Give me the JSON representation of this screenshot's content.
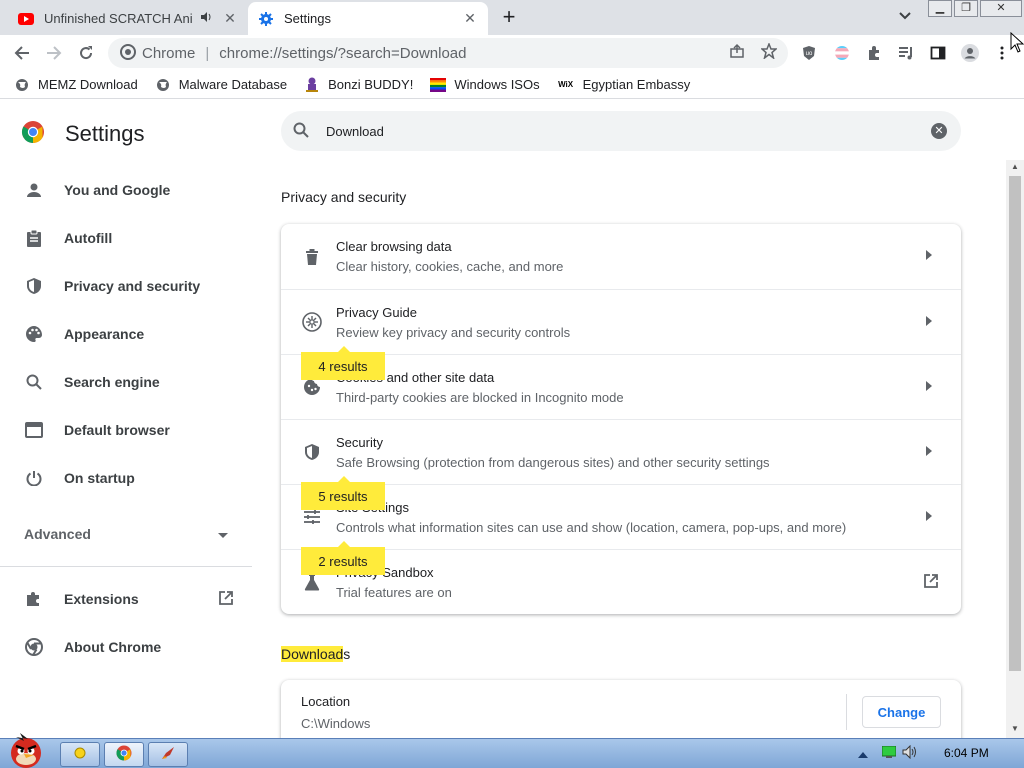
{
  "tabs": [
    {
      "title": "Unfinished SCRATCH Anim",
      "favicon": "youtube-icon",
      "audio": true,
      "active": false
    },
    {
      "title": "Settings",
      "favicon": "settings-gear-icon",
      "audio": false,
      "active": true
    }
  ],
  "omnibox": {
    "site_label": "Chrome",
    "url": "chrome://settings/?search=Download"
  },
  "bookmarks": [
    {
      "label": "MEMZ Download",
      "icon": "globe-icon"
    },
    {
      "label": "Malware Database",
      "icon": "globe-icon"
    },
    {
      "label": "Bonzi BUDDY!",
      "icon": "bonzi-icon"
    },
    {
      "label": "Windows ISOs",
      "icon": "pride-flag-icon"
    },
    {
      "label": "Egyptian Embassy",
      "icon": "wix-icon"
    }
  ],
  "settings": {
    "title": "Settings",
    "search_value": "Download",
    "nav": [
      {
        "label": "You and Google",
        "icon": "person-icon"
      },
      {
        "label": "Autofill",
        "icon": "clipboard-icon"
      },
      {
        "label": "Privacy and security",
        "icon": "shield-icon"
      },
      {
        "label": "Appearance",
        "icon": "palette-icon"
      },
      {
        "label": "Search engine",
        "icon": "search-icon"
      },
      {
        "label": "Default browser",
        "icon": "browser-icon"
      },
      {
        "label": "On startup",
        "icon": "power-icon"
      }
    ],
    "advanced_label": "Advanced",
    "extensions_label": "Extensions",
    "about_label": "About Chrome",
    "privacy_section_title": "Privacy and security",
    "privacy_rows": [
      {
        "label": "Clear browsing data",
        "sub": "Clear history, cookies, cache, and more",
        "icon": "trash-icon",
        "bubble": "",
        "action": "arrow"
      },
      {
        "label": "Privacy Guide",
        "sub": "Review key privacy and security controls",
        "icon": "privacy-guide-icon",
        "bubble": "",
        "action": "arrow"
      },
      {
        "label": "Cookies and other site data",
        "sub": "Third-party cookies are blocked in Incognito mode",
        "icon": "cookie-icon",
        "bubble": "4 results",
        "action": "arrow"
      },
      {
        "label": "Security",
        "sub": "Safe Browsing (protection from dangerous sites) and other security settings",
        "icon": "shield-icon",
        "bubble": "",
        "action": "arrow"
      },
      {
        "label": "Site Settings",
        "sub": "Controls what information sites can use and show (location, camera, pop-ups, and more)",
        "icon": "sliders-icon",
        "bubble": "5 results",
        "action": "arrow"
      },
      {
        "label": "Privacy Sandbox",
        "sub": "Trial features are on",
        "icon": "flask-icon",
        "bubble": "2 results",
        "action": "external"
      }
    ],
    "downloads_title_highlight": "Download",
    "downloads_title_rest": "s",
    "location_label": "Location",
    "location_value": "C:\\Windows",
    "change_button": "Change"
  },
  "taskbar": {
    "clock": "6:04 PM"
  },
  "colors": {
    "accent": "#1a73e8",
    "highlight": "#ffeb3b",
    "tabstrip": "#dee1e6"
  }
}
